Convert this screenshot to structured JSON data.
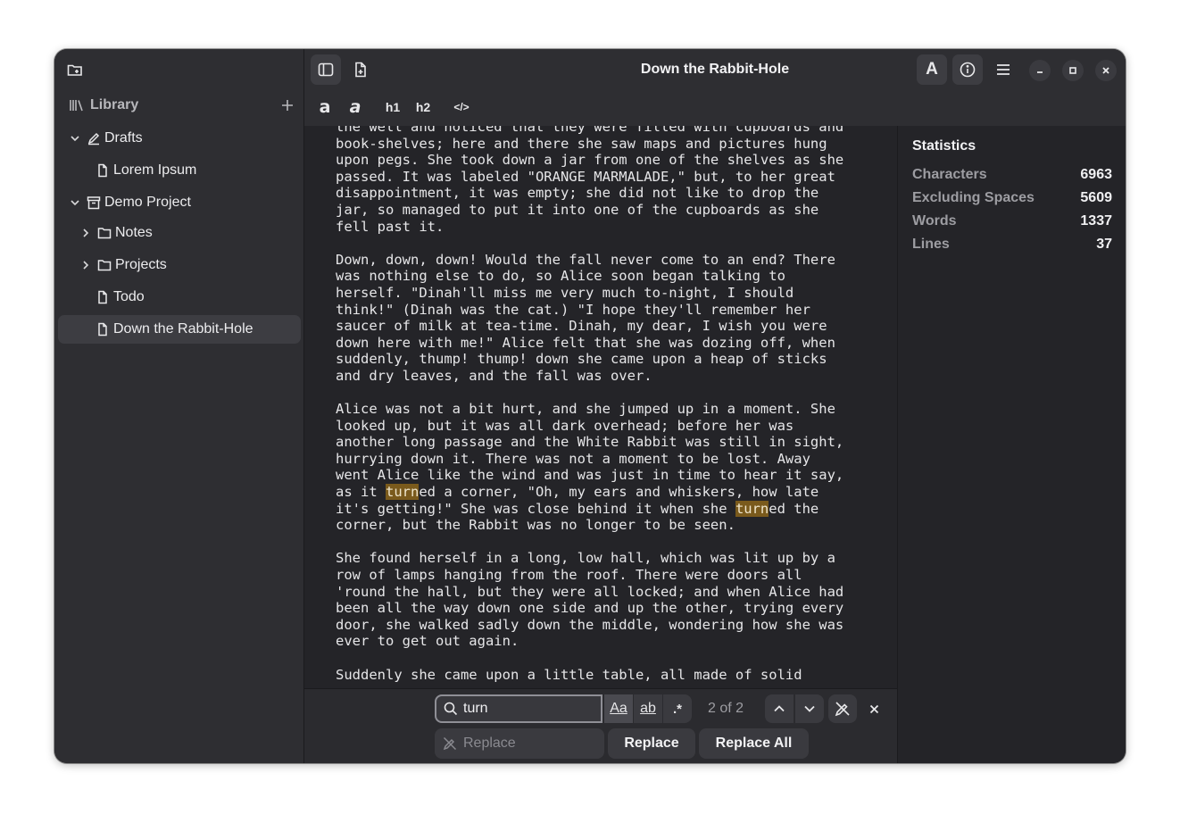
{
  "window": {
    "title": "Down the Rabbit-Hole"
  },
  "sidebar": {
    "library_label": "Library",
    "tree": [
      {
        "label": "Drafts",
        "type": "drafts",
        "expanded": true
      },
      {
        "label": "Lorem Ipsum",
        "type": "file"
      },
      {
        "label": "Demo Project",
        "type": "project",
        "expanded": true
      },
      {
        "label": "Notes",
        "type": "folder",
        "expanded": false
      },
      {
        "label": "Projects",
        "type": "folder",
        "expanded": false
      },
      {
        "label": "Todo",
        "type": "file"
      },
      {
        "label": "Down the Rabbit-Hole",
        "type": "file",
        "selected": true
      }
    ]
  },
  "toolbar": {
    "bold_label": "a",
    "italic_label": "a",
    "h1_label": "h1",
    "h2_label": "h2",
    "code_label": "</>"
  },
  "editor": {
    "search_term": "turn",
    "lines": [
      "the well and noticed that they were filled with cupboards and",
      "book-shelves; here and there she saw maps and pictures hung",
      "upon pegs. She took down a jar from one of the shelves as she",
      "passed. It was labeled \"ORANGE MARMALADE,\" but, to her great",
      "disappointment, it was empty; she did not like to drop the",
      "jar, so managed to put it into one of the cupboards as she",
      "fell past it.",
      "",
      "Down, down, down! Would the fall never come to an end? There",
      "was nothing else to do, so Alice soon began talking to",
      "herself. \"Dinah'll miss me very much to-night, I should",
      "think!\" (Dinah was the cat.) \"I hope they'll remember her",
      "saucer of milk at tea-time. Dinah, my dear, I wish you were",
      "down here with me!\" Alice felt that she was dozing off, when",
      "suddenly, thump! thump! down she came upon a heap of sticks",
      "and dry leaves, and the fall was over.",
      "",
      "Alice was not a bit hurt, and she jumped up in a moment. She",
      "looked up, but it was all dark overhead; before her was",
      "another long passage and the White Rabbit was still in sight,",
      "hurrying down it. There was not a moment to be lost. Away",
      "went Alice like the wind and was just in time to hear it say,",
      "as it turned a corner, \"Oh, my ears and whiskers, how late",
      "it's getting!\" She was close behind it when she turned the",
      "corner, but the Rabbit was no longer to be seen.",
      "",
      "She found herself in a long, low hall, which was lit up by a",
      "row of lamps hanging from the roof. There were doors all",
      "'round the hall, but they were all locked; and when Alice had",
      "been all the way down one side and up the other, trying every",
      "door, she walked sadly down the middle, wondering how she was",
      "ever to get out again.",
      "",
      "Suddenly she came upon a little table, all made of solid"
    ]
  },
  "statistics": {
    "title": "Statistics",
    "rows": [
      {
        "label": "Characters",
        "value": "6963"
      },
      {
        "label": "Excluding Spaces",
        "value": "5609"
      },
      {
        "label": "Words",
        "value": "1337"
      },
      {
        "label": "Lines",
        "value": "37"
      }
    ]
  },
  "findbar": {
    "search_value": "turn",
    "match_count": "2 of 2",
    "replace_placeholder": "Replace",
    "replace_label": "Replace",
    "replace_all_label": "Replace All",
    "case_label": "Aa",
    "word_label": "ab",
    "regex_label": ".*"
  },
  "colors": {
    "highlight": "#7a5a1c",
    "sidebar_bg": "#2e2e32",
    "editor_bg": "#242428"
  }
}
